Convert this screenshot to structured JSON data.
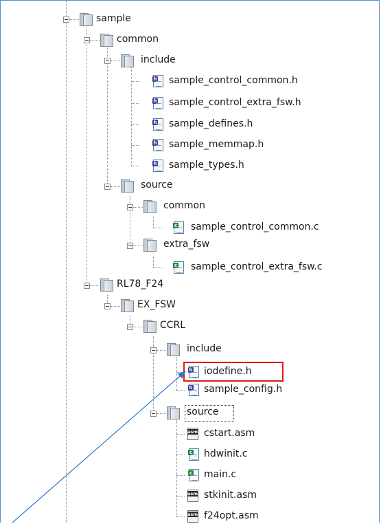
{
  "tree": {
    "sample": "sample",
    "common": "common",
    "include": "include",
    "h1": "sample_control_common.h",
    "h2": "sample_control_extra_fsw.h",
    "h3": "sample_defines.h",
    "h4": "sample_memmap.h",
    "h5": "sample_types.h",
    "source": "source",
    "src_common": "common",
    "c1": "sample_control_common.c",
    "extra_fsw": "extra_fsw",
    "c2": "sample_control_extra_fsw.c",
    "rl78": "RL78_F24",
    "exfsw": "EX_FSW",
    "ccrl": "CCRL",
    "ccrl_include": "include",
    "iodefine": "iodefine.h",
    "sample_config": "sample_config.h",
    "ccrl_source": "source",
    "cstart": "cstart.asm",
    "hdwinit": "hdwinit.c",
    "main": "main.c",
    "stkinit": "stkinit.asm",
    "f24opt": "f24opt.asm"
  },
  "icons": {
    "h_badge": "h",
    "c_badge": "c",
    "asm_badge": "asm"
  },
  "colors": {
    "highlight": "#e31b1b",
    "arrow": "#2f78c4",
    "frame": "#4a8fd4"
  }
}
